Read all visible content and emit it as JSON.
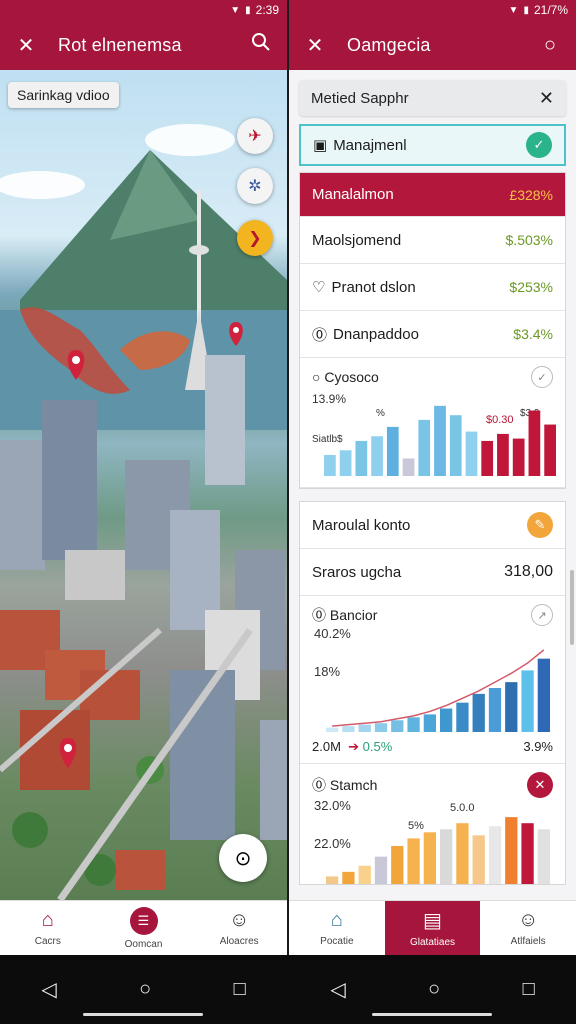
{
  "left": {
    "status_time": "2:39",
    "title": "Rot elnenemsa",
    "map_chip": "Sarinkag vdioo",
    "nav": [
      {
        "label": "Cacrs",
        "icon": "home-icon"
      },
      {
        "label": "Oomcan",
        "icon": "chat-icon"
      },
      {
        "label": "Aloacres",
        "icon": "person-icon"
      }
    ]
  },
  "right": {
    "status_time": "21/7%",
    "title": "Oamgecia",
    "search_text": "Metied Sapphr",
    "highlight_row": {
      "label": "Manajmenl"
    },
    "red_row": {
      "label": "Manalalmon",
      "value": "£328%"
    },
    "rows": [
      {
        "label": "Maolsjomend",
        "value": "$.503%"
      },
      {
        "label": "Pranot dslon",
        "value": "$253%"
      },
      {
        "label": "Dnanpaddoo",
        "value": "$3.4%"
      }
    ],
    "chart1": {
      "title": "Cyosoco",
      "y_label": "13.9%",
      "annotations": [
        "%",
        "$0.30",
        "$3.9",
        "$3.9"
      ],
      "left_tick": "Siatlb$"
    },
    "section2_title": "Maroulal konto",
    "summary_row": {
      "label": "Sraros ugcha",
      "value": "318,00"
    },
    "chart2": {
      "title": "Bancior",
      "y_top": "40.2%",
      "y_mid": "18%",
      "foot_left": "2.0M",
      "foot_delta": "0.5%",
      "foot_right": "3.9%"
    },
    "chart3": {
      "title": "Stamch",
      "y_top": "32.0%",
      "y_mid": "22.0%",
      "annotations": [
        "5.0.0",
        "5%"
      ]
    },
    "nav": [
      {
        "label": "Pocatie",
        "icon": "home-icon"
      },
      {
        "label": "Glatatiaes",
        "icon": "dashboard-icon"
      },
      {
        "label": "Atlfaiels",
        "icon": "person-icon"
      }
    ]
  },
  "colors": {
    "brand": "#a6163c",
    "teal": "#4cc2c9",
    "bar_blue": "#7ac4e6",
    "bar_red": "#c0163a",
    "bar_orange": "#f2a53a"
  },
  "chart_data": [
    {
      "type": "bar",
      "values": [
        18,
        22,
        30,
        34,
        42,
        15,
        48,
        60,
        52,
        38,
        30,
        36,
        32,
        56,
        44
      ],
      "colors": [
        "#8fd0ee",
        "#8fd0ee",
        "#7ac4e6",
        "#8fd0ee",
        "#5fb0e0",
        "#c8c8d8",
        "#7ac4e6",
        "#6bb8e4",
        "#7ac4e6",
        "#8fd0ee",
        "#c0163a",
        "#c0163a",
        "#c0163a",
        "#c0163a",
        "#c0163a"
      ],
      "ylim": [
        0,
        65
      ]
    },
    {
      "type": "bar",
      "values": [
        3,
        4,
        5,
        6,
        8,
        10,
        12,
        16,
        20,
        26,
        30,
        34,
        42,
        50
      ],
      "line": [
        4,
        5,
        6,
        7,
        9,
        11,
        14,
        18,
        23,
        28,
        34,
        40,
        47,
        56
      ],
      "ylim": [
        0,
        60
      ]
    },
    {
      "type": "bar",
      "values": [
        5,
        8,
        12,
        18,
        25,
        30,
        34,
        36,
        40,
        32,
        38,
        44,
        40,
        36
      ],
      "colors": [
        "#f2c88a",
        "#f2a53a",
        "#f8d28a",
        "#c8c8d8",
        "#f2a53a",
        "#f5b24e",
        "#f5b24e",
        "#d9d9d9",
        "#f5b24e",
        "#f7c68a",
        "#e7e7e7",
        "#f08030",
        "#c0163a",
        "#e0e0e0"
      ],
      "ylim": [
        0,
        50
      ]
    }
  ]
}
